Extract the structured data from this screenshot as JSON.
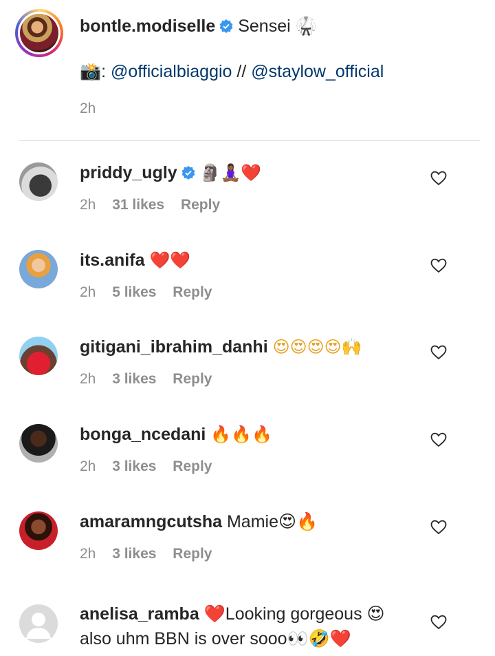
{
  "post": {
    "author": "bontle.modiselle",
    "caption_text": "Sensei 🥋",
    "credit_prefix": "📸:",
    "mention1": "@officialbiaggio",
    "separator": " // ",
    "mention2": "@staylow_official",
    "time": "2h"
  },
  "colors": {
    "link": "#00376b",
    "verified": "#3897f0",
    "muted": "#8e8e8e",
    "heart_red": "#e0102a"
  },
  "comments": [
    {
      "user": "priddy_ugly",
      "verified": true,
      "text": "🗿🧘🏾‍♀️❤️",
      "time": "2h",
      "likes": "31 likes",
      "reply": "Reply"
    },
    {
      "user": "its.anifa",
      "verified": false,
      "text": "❤️❤️",
      "time": "2h",
      "likes": "5 likes",
      "reply": "Reply"
    },
    {
      "user": "gitigani_ibrahim_danhi",
      "verified": false,
      "text": "😍😍😍😍🙌",
      "time": "2h",
      "likes": "3 likes",
      "reply": "Reply"
    },
    {
      "user": "bonga_ncedani",
      "verified": false,
      "text": "🔥🔥🔥",
      "time": "2h",
      "likes": "3 likes",
      "reply": "Reply"
    },
    {
      "user": "amaramngcutsha",
      "verified": false,
      "text": "Mamie😍🔥",
      "time": "2h",
      "likes": "3 likes",
      "reply": "Reply"
    },
    {
      "user": "anelisa_ramba",
      "verified": false,
      "text": "❤️Looking gorgeous 😍",
      "text_line2": "also uhm BBN is over sooo👀🤣❤️"
    }
  ],
  "icons": {
    "verified": "verified-badge-icon",
    "like": "heart-outline-icon",
    "avatar_placeholder": "default-avatar-icon"
  }
}
